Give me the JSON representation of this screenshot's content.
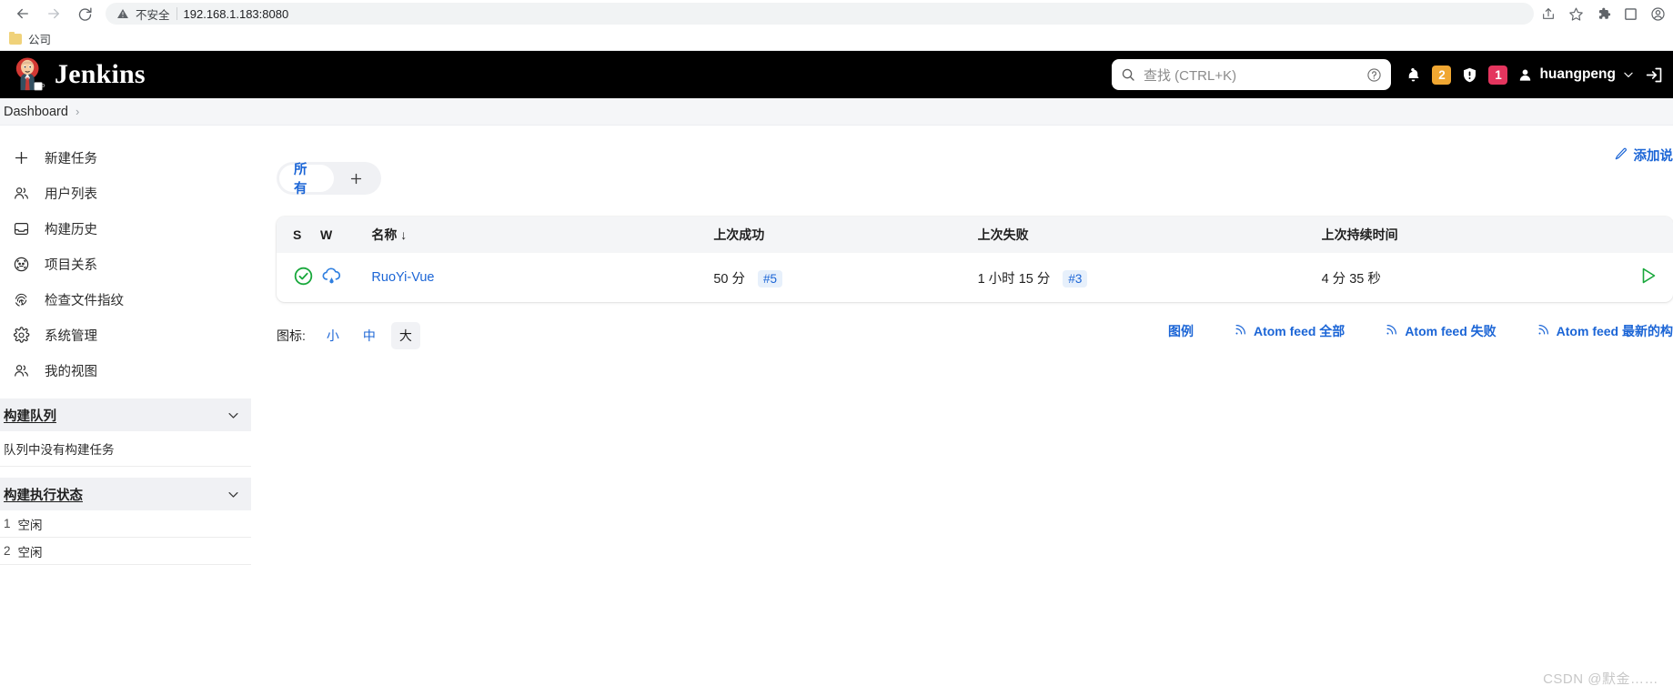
{
  "browser": {
    "back_icon": "arrow-left-icon",
    "forward_icon": "arrow-right-icon",
    "reload_icon": "reload-icon",
    "security_label": "不安全",
    "url": "192.168.1.183:8080",
    "toolbar_icons": [
      "share-icon",
      "star-icon",
      "extensions-puzzle-icon",
      "sidebar-icon",
      "profile-icon"
    ],
    "bookmark": {
      "label": "公司",
      "icon": "folder-icon"
    }
  },
  "header": {
    "logo_alt": "jenkins-butler-logo",
    "title": "Jenkins",
    "search": {
      "placeholder": "查找 (CTRL+K)",
      "icon": "search-icon",
      "help_icon": "question-circle-icon"
    },
    "notifications": {
      "icon": "bell-icon",
      "count": "2",
      "color": "#f0a732"
    },
    "security": {
      "icon": "shield-warning-icon",
      "count": "1",
      "color": "#e4355e"
    },
    "user": {
      "icon": "person-icon",
      "name": "huangpeng",
      "chevron": "chevron-down-icon"
    },
    "logout_icon": "logout-icon"
  },
  "breadcrumb": {
    "items": [
      "Dashboard"
    ],
    "separator": "›"
  },
  "sidebar": {
    "items": [
      {
        "label": "新建任务",
        "icon": "plus-icon"
      },
      {
        "label": "用户列表",
        "icon": "people-icon"
      },
      {
        "label": "构建历史",
        "icon": "inbox-icon"
      },
      {
        "label": "项目关系",
        "icon": "relations-circle-icon"
      },
      {
        "label": "检查文件指纹",
        "icon": "fingerprint-icon"
      },
      {
        "label": "系统管理",
        "icon": "gear-icon"
      },
      {
        "label": "我的视图",
        "icon": "people-icon"
      }
    ],
    "build_queue": {
      "title": "构建队列",
      "chevron": "chevron-down-icon",
      "empty_text": "队列中没有构建任务"
    },
    "executors": {
      "title": "构建执行状态",
      "chevron": "chevron-down-icon",
      "rows": [
        {
          "num": "1",
          "status": "空闲"
        },
        {
          "num": "2",
          "status": "空闲"
        }
      ]
    }
  },
  "main": {
    "add_description": {
      "label": "添加说",
      "icon": "pencil-icon"
    },
    "tabs": {
      "active": "所有",
      "add_icon": "plus-icon"
    },
    "table": {
      "headers": {
        "s": "S",
        "w": "W",
        "name": "名称 ↓",
        "last_success": "上次成功",
        "last_failure": "上次失败",
        "last_duration": "上次持续时间"
      },
      "rows": [
        {
          "status_icon": "status-success-check-icon",
          "status_color": "#19a83c",
          "weather_icon": "weather-cloud-rain-icon",
          "weather_color": "#2f7fe0",
          "name": "RuoYi-Vue",
          "last_success": "50 分",
          "last_success_build": "#5",
          "last_failure": "1 小时 15 分",
          "last_failure_build": "#3",
          "last_duration": "4 分 35 秒",
          "action_icon": "play-build-icon"
        }
      ]
    },
    "footer": {
      "icons_label": "图标:",
      "sizes": [
        {
          "label": "小",
          "active": false
        },
        {
          "label": "中",
          "active": false
        },
        {
          "label": "大",
          "active": true
        }
      ],
      "legend": "图例",
      "feeds": [
        {
          "label": "Atom feed 全部",
          "icon": "rss-icon"
        },
        {
          "label": "Atom feed 失败",
          "icon": "rss-icon"
        },
        {
          "label": "Atom feed 最新的构",
          "icon": "rss-icon"
        }
      ]
    }
  },
  "watermark": "CSDN @默金……"
}
